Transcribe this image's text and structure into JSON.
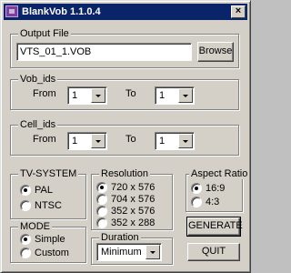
{
  "window": {
    "title": "BlankVob 1.1.0.4",
    "close_glyph": "×"
  },
  "output_file": {
    "legend": "Output File",
    "value": "VTS_01_1.VOB",
    "browse_label": "Browse"
  },
  "vob_ids": {
    "legend": "Vob_ids",
    "from_label": "From",
    "from_value": "1",
    "to_label": "To",
    "to_value": "1"
  },
  "cell_ids": {
    "legend": "Cell_ids",
    "from_label": "From",
    "from_value": "1",
    "to_label": "To",
    "to_value": "1"
  },
  "tv_system": {
    "legend": "TV-SYSTEM",
    "options": [
      {
        "label": "PAL",
        "selected": true
      },
      {
        "label": "NTSC",
        "selected": false
      }
    ]
  },
  "resolution": {
    "legend": "Resolution",
    "options": [
      {
        "label": "720 x 576",
        "selected": true
      },
      {
        "label": "704 x 576",
        "selected": false
      },
      {
        "label": "352 x 576",
        "selected": false
      },
      {
        "label": "352 x 288",
        "selected": false
      }
    ]
  },
  "aspect_ratio": {
    "legend": "Aspect Ratio",
    "options": [
      {
        "label": "16:9",
        "selected": true
      },
      {
        "label": "4:3",
        "selected": false
      }
    ]
  },
  "mode": {
    "legend": "MODE",
    "options": [
      {
        "label": "Simple",
        "selected": true
      },
      {
        "label": "Custom",
        "selected": false
      }
    ]
  },
  "duration": {
    "legend": "Duration",
    "value": "Minimum"
  },
  "actions": {
    "generate_label": "GENERATE",
    "quit_label": "QUIT"
  }
}
